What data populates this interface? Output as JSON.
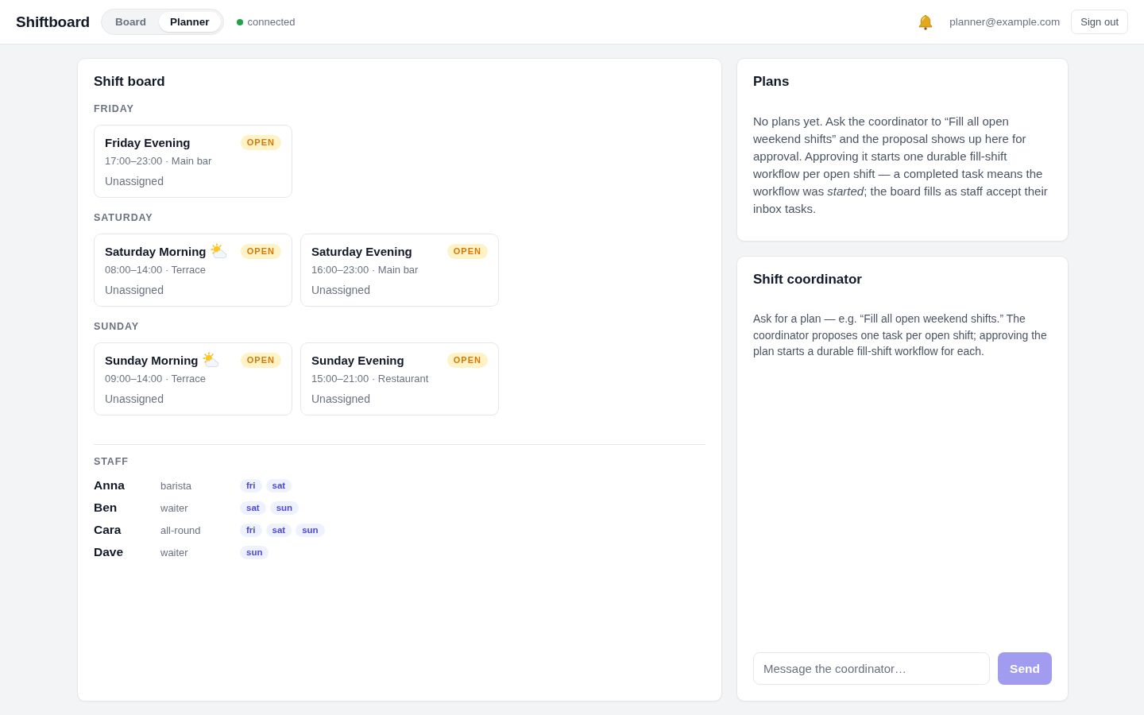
{
  "header": {
    "logo": "Shiftboard",
    "tabs": [
      {
        "label": "Board",
        "selected": false
      },
      {
        "label": "Planner",
        "selected": true
      }
    ],
    "status": {
      "label": "connected",
      "online": true
    },
    "user_email": "planner@example.com",
    "sign_out": "Sign out"
  },
  "shift_board": {
    "title": "Shift board",
    "days": [
      {
        "label": "FRIDAY",
        "shifts": [
          {
            "title": "Friday Evening",
            "kind": "evening",
            "badge": "OPEN",
            "meta": "17:00–23:00 · Main bar",
            "assignee": "Unassigned"
          }
        ]
      },
      {
        "label": "SATURDAY",
        "shifts": [
          {
            "title": "Saturday Morning",
            "kind": "morning",
            "badge": "OPEN",
            "meta": "08:00–14:00 · Terrace",
            "assignee": "Unassigned"
          },
          {
            "title": "Saturday Evening",
            "kind": "evening",
            "badge": "OPEN",
            "meta": "16:00–23:00 · Main bar",
            "assignee": "Unassigned"
          }
        ]
      },
      {
        "label": "SUNDAY",
        "shifts": [
          {
            "title": "Sunday Morning",
            "kind": "morning",
            "badge": "OPEN",
            "meta": "09:00–14:00 · Terrace",
            "assignee": "Unassigned"
          },
          {
            "title": "Sunday Evening",
            "kind": "evening",
            "badge": "OPEN",
            "meta": "15:00–21:00 · Restaurant",
            "assignee": "Unassigned"
          }
        ]
      }
    ],
    "staff": {
      "label": "STAFF",
      "members": [
        {
          "name": "Anna",
          "role": "barista",
          "days": [
            "fri",
            "sat"
          ]
        },
        {
          "name": "Ben",
          "role": "waiter",
          "days": [
            "sat",
            "sun"
          ]
        },
        {
          "name": "Cara",
          "role": "all-round",
          "days": [
            "fri",
            "sat",
            "sun"
          ]
        },
        {
          "name": "Dave",
          "role": "waiter",
          "days": [
            "sun"
          ]
        }
      ]
    }
  },
  "plans": {
    "title": "Plans",
    "text": "No plans yet. Ask the coordinator to “Fill all open weekend shifts” and the proposal shows up here for approval. Approving it starts one durable fill-shift workflow per open shift — a completed task means the workflow was *started*; the board fills as staff accept their inbox tasks."
  },
  "coordinator": {
    "title": "Shift coordinator",
    "text": "Ask for a plan — e.g. “Fill all open weekend shifts.” The coordinator proposes one task per open shift; approving the plan starts a durable fill-shift workflow for each.",
    "input": {
      "placeholder": "Message the coordinator…"
    },
    "send": {
      "label": "Send",
      "disabled": true
    }
  }
}
